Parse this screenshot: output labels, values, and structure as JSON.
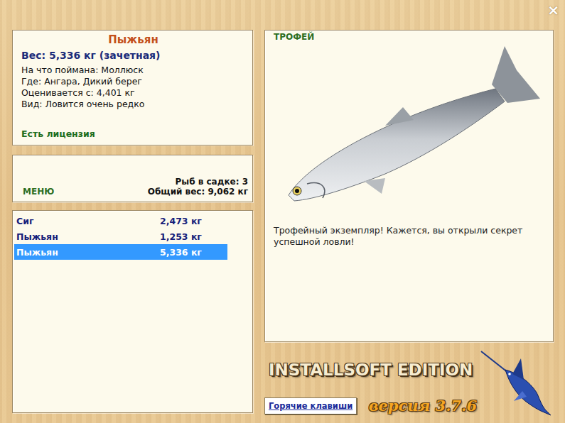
{
  "window": {
    "close": "×"
  },
  "fish_card": {
    "name": "Пыжьян",
    "weight": "Вес: 5,336 кг (зачетная)",
    "details": [
      "На что поймана: Моллюск",
      "Где: Ангара, Дикий берег",
      "Оценивается с: 4,401 кг",
      "Вид: Ловится очень редко"
    ],
    "license": "Есть лицензия"
  },
  "menu_panel": {
    "menu": "МЕНЮ",
    "count": "Рыб в садке: 3",
    "total": "Общий вес: 9,062 кг"
  },
  "catch_list": [
    {
      "name": "Сиг",
      "weight": "2,473 кг",
      "selected": false
    },
    {
      "name": "Пыжьян",
      "weight": "1,253 кг",
      "selected": false
    },
    {
      "name": "Пыжьян",
      "weight": "5,336 кг",
      "selected": true
    }
  ],
  "trophy": {
    "label": "ТРОФЕЙ",
    "message": "Трофейный экземпляр! Кажется, вы открыли секрет успешной ловли!"
  },
  "hotkeys_button": "Горячие клавиши",
  "logo": {
    "title": "INSTALLSOFT EDITION",
    "version": "версия 3.7.6"
  }
}
